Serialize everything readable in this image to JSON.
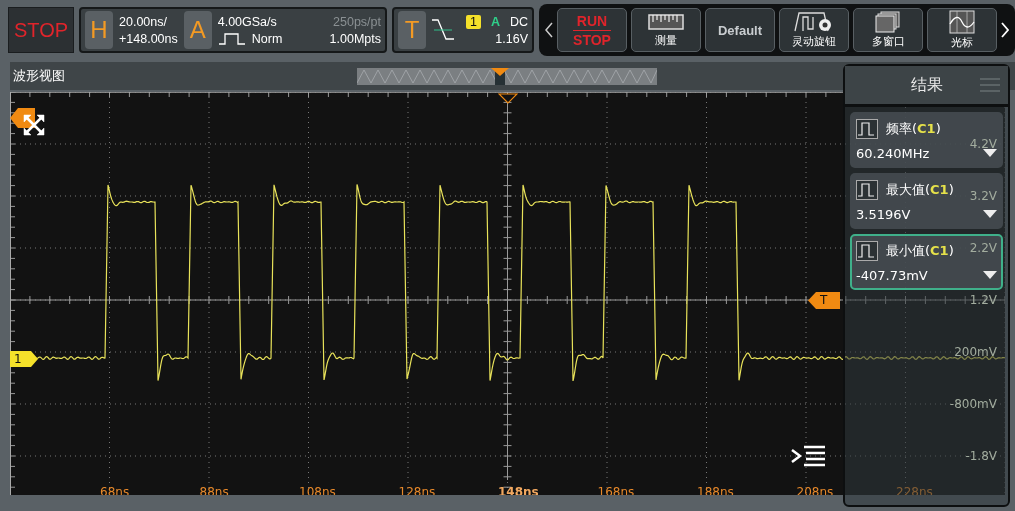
{
  "status": {
    "run_state": "STOP"
  },
  "horizontal": {
    "badge": "H",
    "scale": "20.00ns/",
    "offset": "+148.00ns"
  },
  "acquisition": {
    "badge": "A",
    "sample_rate": "4.00GSa/s",
    "mode": "Norm",
    "resolution": "250ps/pt",
    "memory_depth": "1.00Mpts"
  },
  "trigger": {
    "badge": "T",
    "source": "1",
    "sweep": "A",
    "coupling": "DC",
    "level": "1.16V"
  },
  "toolbar": [
    {
      "kind": "run_stop",
      "label": "RUN",
      "label_2": "STOP"
    },
    {
      "kind": "ruler",
      "label": "测量"
    },
    {
      "kind": "logo",
      "label": "Default"
    },
    {
      "kind": "knob",
      "label": "灵动旋钮"
    },
    {
      "kind": "windows",
      "label": "多窗口"
    },
    {
      "kind": "cursor",
      "label": "光标"
    }
  ],
  "waveform_view": {
    "title": "波形视图",
    "channel_marker": "1",
    "trigger_marker": "T",
    "time_labels": [
      {
        "text": "68ns",
        "bold": false
      },
      {
        "text": "88ns",
        "bold": false
      },
      {
        "text": "108ns",
        "bold": false
      },
      {
        "text": "128ns",
        "bold": false
      },
      {
        "text": "148ns",
        "bold": true
      },
      {
        "text": "168ns",
        "bold": false
      },
      {
        "text": "188ns",
        "bold": false
      },
      {
        "text": "208ns",
        "bold": false
      },
      {
        "text": "228ns",
        "bold": false
      }
    ],
    "voltage_labels": [
      "4.2V",
      "3.2V",
      "2.2V",
      "1.2V",
      "200mV",
      "-800mV",
      "-1.8V"
    ]
  },
  "results": {
    "title": "结果",
    "items": [
      {
        "name": "频率(**C1**)",
        "value": "60.240MHz",
        "selected": false
      },
      {
        "name": "最大值(**C1**)",
        "value": "3.5196V",
        "selected": false
      },
      {
        "name": "最小值(**C1**)",
        "value": "-407.73mV",
        "selected": true
      }
    ]
  }
}
